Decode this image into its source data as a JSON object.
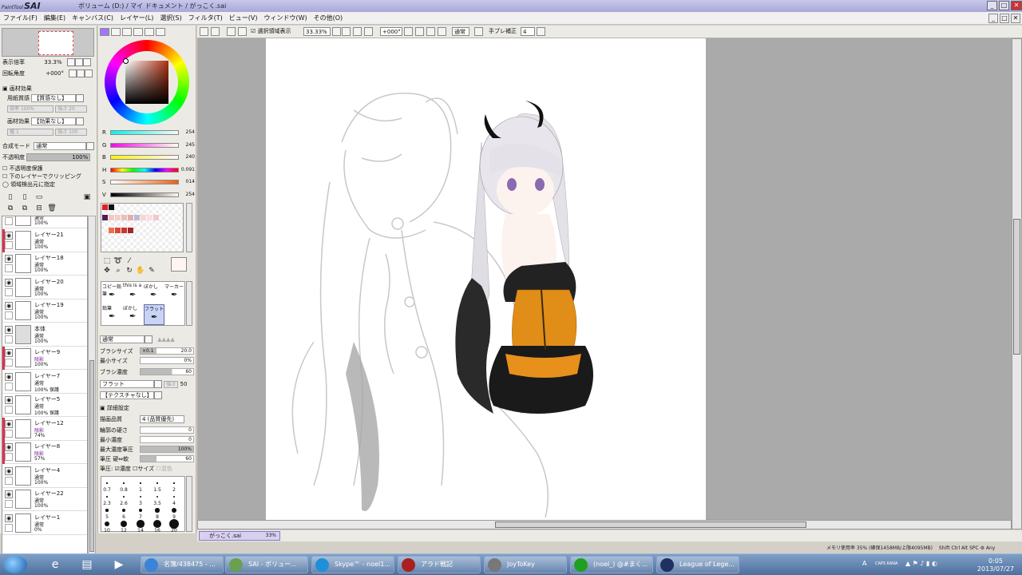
{
  "window": {
    "logo_small": "PaintTool",
    "logo": "SAI",
    "title": "ボリューム (D:) / マイ ドキュメント / がっこく.sai",
    "btn_min": "_",
    "btn_max": "□",
    "btn_close": "✕"
  },
  "menu": [
    "ファイル(F)",
    "編集(E)",
    "キャンバス(C)",
    "レイヤー(L)",
    "選択(S)",
    "フィルタ(T)",
    "ビュー(V)",
    "ウィンドウ(W)",
    "その他(O)"
  ],
  "navigator": {
    "zoom_label": "表示倍率",
    "zoom_value": "33.3%",
    "angle_label": "回転角度",
    "angle_value": "+000°"
  },
  "paper_effects": {
    "header": "画材効果",
    "texture_label": "用紙質感",
    "texture_value": "【質感なし】",
    "texture_scale": "倍率",
    "texture_scale_value": "100%",
    "texture_strength": "強さ",
    "texture_strength_value": "20",
    "effect_label": "画材効果",
    "effect_value": "【効果なし】",
    "effect_width": "幅",
    "effect_width_value": "1",
    "effect_strength": "強さ",
    "effect_strength_value": "100"
  },
  "blend": {
    "mode_label": "合成モード",
    "mode_value": "通常",
    "opacity_label": "不透明度",
    "opacity_value": "100%",
    "opt1": "不透明度保護",
    "opt2": "下のレイヤーでクリッピング",
    "opt3": "領域検出元に指定"
  },
  "layers": [
    {
      "name": "",
      "mode": "通常",
      "opacity": "100%",
      "mark": ""
    },
    {
      "name": "レイヤー21",
      "mode": "通常",
      "opacity": "100%",
      "mark": "#e03050"
    },
    {
      "name": "レイヤー18",
      "mode": "通常",
      "opacity": "100%",
      "mark": ""
    },
    {
      "name": "レイヤー20",
      "mode": "通常",
      "opacity": "100%",
      "mark": ""
    },
    {
      "name": "レイヤー19",
      "mode": "通常",
      "opacity": "100%",
      "mark": ""
    },
    {
      "name": "本体",
      "mode": "通常",
      "opacity": "100%",
      "mark": ""
    },
    {
      "name": "レイヤー9",
      "mode": "陰影",
      "opacity": "100%",
      "mark": "#e03050"
    },
    {
      "name": "レイヤー7",
      "mode": "通常",
      "opacity": "100% 保護",
      "mark": ""
    },
    {
      "name": "レイヤー5",
      "mode": "通常",
      "opacity": "100% 保護",
      "mark": ""
    },
    {
      "name": "レイヤー12",
      "mode": "陰影",
      "opacity": "74%",
      "mark": "#e03050"
    },
    {
      "name": "レイヤー8",
      "mode": "陰影",
      "opacity": "57%",
      "mark": "#e03050"
    },
    {
      "name": "レイヤー4",
      "mode": "通常",
      "opacity": "100%",
      "mark": ""
    },
    {
      "name": "レイヤー22",
      "mode": "通常",
      "opacity": "100%",
      "mark": ""
    },
    {
      "name": "レイヤー1",
      "mode": "通常",
      "opacity": "0%",
      "mark": ""
    }
  ],
  "color": {
    "r_label": "R",
    "r_value": "254",
    "g_label": "G",
    "g_value": "245",
    "b_label": "B",
    "b_value": "240",
    "h_label": "H",
    "h_value": "0.091",
    "s_label": "S",
    "s_value": "014",
    "v_label": "V",
    "v_value": "254",
    "current": "#fef5f0"
  },
  "brushes": [
    {
      "label": "コピー鉛筆",
      "selected": false
    },
    {
      "label": "this is a",
      "selected": false
    },
    {
      "label": "ぼかし",
      "selected": false
    },
    {
      "label": "マーカー",
      "selected": false
    },
    {
      "label": "鉛筆",
      "selected": false
    },
    {
      "label": "ぼかし",
      "selected": false
    },
    {
      "label": "フラット",
      "selected": true
    }
  ],
  "brush_props": {
    "mode_value": "通常",
    "size_label": "ブラシサイズ",
    "size_mult": "×0.1",
    "size_value": "20.0",
    "min_size_label": "最小サイズ",
    "min_size_value": "0%",
    "density_label": "ブラシ濃度",
    "density_value": "60",
    "shape_value": "フラット",
    "shape_strength_label": "強さ",
    "shape_strength_value": "50",
    "texture_value": "【テクスチャなし】",
    "detail_header": "詳細設定",
    "quality_label": "描画品質",
    "quality_value": "4 (品質優先)",
    "edge_label": "輪郭の硬さ",
    "edge_value": "0",
    "min_density_label": "最小濃度",
    "min_density_value": "0",
    "max_pressure_label": "最大濃度筆圧",
    "max_pressure_value": "100%",
    "pressure_label": "筆圧 硬⇔軟",
    "pressure_value": "60",
    "pressure_opts_label": "筆圧:",
    "opt_density": "濃度",
    "opt_size": "サイズ",
    "opt_blend": "混色"
  },
  "sizes": [
    "0.7",
    "0.8",
    "1",
    "1.5",
    "2",
    "2.3",
    "2.6",
    "3",
    "3.5",
    "4",
    "5",
    "6",
    "7",
    "8",
    "9",
    "10",
    "12",
    "14",
    "16",
    "20"
  ],
  "toolbar": {
    "show_selection": "選択領域表示",
    "zoom": "33.33%",
    "angle": "+000°",
    "mode": "通常",
    "stabilizer_label": "手ブレ補正",
    "stabilizer_value": "4"
  },
  "document_tab": {
    "name": "がっこく.sai",
    "zoom": "33%"
  },
  "status": {
    "memory": "メモリ使用率 35% (確保1458MB/上限4095MB)",
    "keys": "Shift Ctrl Alt SPC ⚙ Any"
  },
  "taskbar": {
    "tasks": [
      {
        "label": "名簿/438475 - ...",
        "color": "#3b84d8"
      },
      {
        "label": "SAI - ボリュー...",
        "color": "#6aa050"
      },
      {
        "label": "Skype™ - noel1...",
        "color": "#1e90d8"
      },
      {
        "label": "アラド戦記",
        "color": "#aa2020"
      },
      {
        "label": "JoyToKey",
        "color": "#777777"
      },
      {
        "label": "(noel_) @#まく...",
        "color": "#20a020"
      },
      {
        "label": "League of Lege...",
        "color": "#203060"
      }
    ],
    "time": "0:05",
    "date": "2013/07/27",
    "tray_lang": "A",
    "tray_text": "CAPS KANA"
  }
}
